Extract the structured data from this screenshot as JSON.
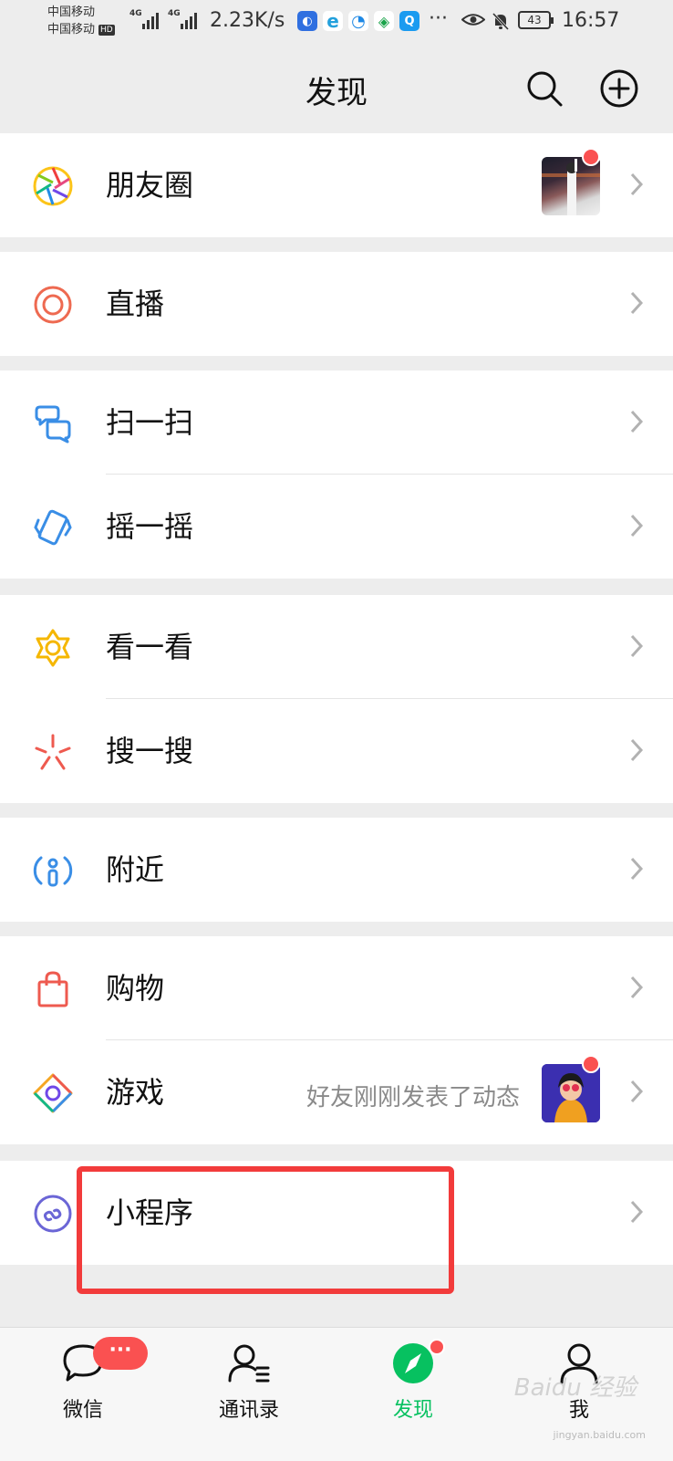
{
  "status": {
    "carrier1": "中国移动",
    "carrier2": "中国移动",
    "hd": "HD",
    "net1": "4G",
    "net2": "4G",
    "speed": "2.23K/s",
    "more": "···",
    "battery": "43",
    "time": "16:57"
  },
  "header": {
    "title": "发现"
  },
  "items": {
    "moments": {
      "label": "朋友圈"
    },
    "live": {
      "label": "直播"
    },
    "scan": {
      "label": "扫一扫"
    },
    "shake": {
      "label": "摇一摇"
    },
    "topstories": {
      "label": "看一看"
    },
    "search": {
      "label": "搜一搜"
    },
    "nearby": {
      "label": "附近"
    },
    "shopping": {
      "label": "购物"
    },
    "games": {
      "label": "游戏",
      "hint": "好友刚刚发表了动态"
    },
    "miniprograms": {
      "label": "小程序"
    }
  },
  "tabs": {
    "chats": {
      "label": "微信",
      "badge": "···"
    },
    "contacts": {
      "label": "通讯录"
    },
    "discover": {
      "label": "发现"
    },
    "me": {
      "label": "我"
    }
  },
  "watermark": {
    "text": "Baidu 经验",
    "sub": "jingyan.baidu.com"
  },
  "colors": {
    "accent": "#07c160",
    "badge": "#fa5151",
    "highlight": "#f23b3b"
  }
}
